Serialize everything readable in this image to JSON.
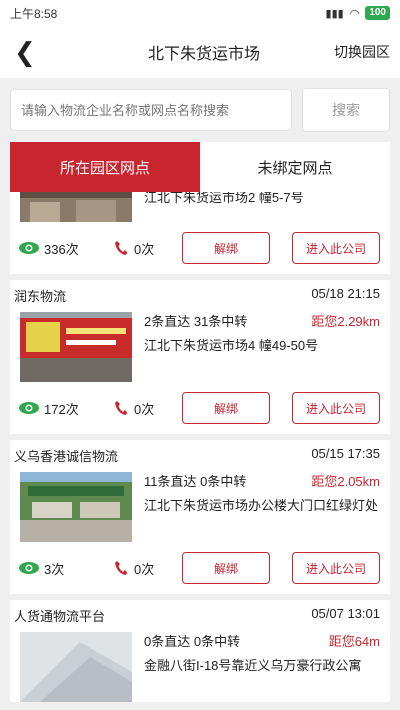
{
  "status": {
    "time": "上午8:58",
    "battery": "100"
  },
  "header": {
    "title": "北下朱货运市场",
    "switch_label": "切换园区"
  },
  "search": {
    "placeholder": "请输入物流企业名称或网点名称搜索",
    "button": "搜索"
  },
  "tabs": [
    {
      "label": "所在园区网点"
    },
    {
      "label": "未绑定网点"
    }
  ],
  "labels": {
    "unbind": "解绑",
    "enter": "进入此公司"
  },
  "cards": [
    {
      "address": "江北下朱货运市场2 幢5-7号",
      "views": "336次",
      "calls": "0次"
    },
    {
      "name": "润东物流",
      "date": "05/18 21:15",
      "routes": "2条直达   31条中转",
      "distance": "距您2.29km",
      "address": "江北下朱货运市场4 幢49-50号",
      "views": "172次",
      "calls": "0次"
    },
    {
      "name": "义乌香港诚信物流",
      "date": "05/15 17:35",
      "routes": "11条直达   0条中转",
      "distance": "距您2.05km",
      "address": "江北下朱货运市场办公楼大门口红绿灯处",
      "views": "3次",
      "calls": "0次"
    },
    {
      "name": "人货通物流平台",
      "date": "05/07 13:01",
      "routes": "0条直达   0条中转",
      "distance": "距您64m",
      "address": "金融八街I-18号靠近义乌万豪行政公寓"
    }
  ],
  "colors": {
    "accent": "#c8262f",
    "eye": "#2ea84f"
  },
  "icons": [
    "back-arrow-icon",
    "eye-icon",
    "phone-icon",
    "wifi-icon",
    "signal-icon"
  ]
}
